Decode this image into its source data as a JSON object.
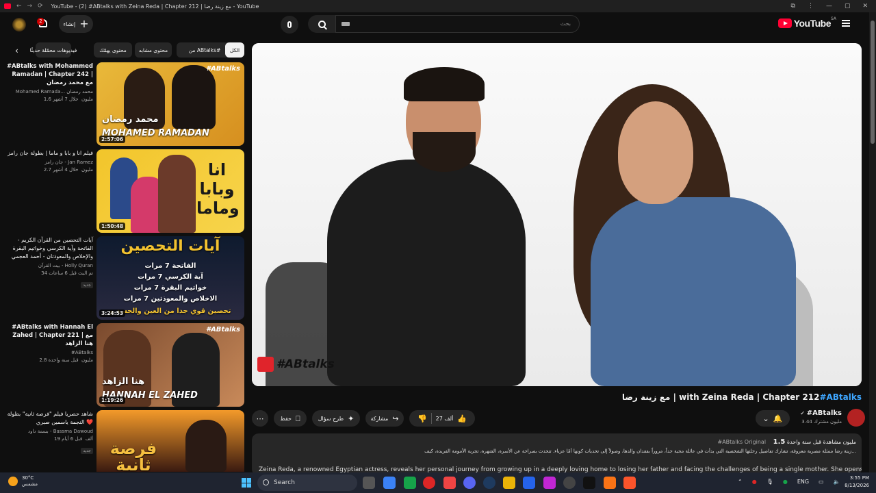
{
  "browser": {
    "title": "YouTube - (2) #ABtalks with Zeina Reda | Chapter 212 | مع زينة رضا - YouTube"
  },
  "header": {
    "logo_text": "YouTube",
    "logo_region": "SA",
    "search_placeholder": "بحث",
    "create_label": "إنشاء",
    "notification_count": "2"
  },
  "chips": [
    {
      "label": "الكل",
      "active": true
    },
    {
      "label": "من ABtalks#",
      "active": false
    },
    {
      "label": "محتوى مشابه",
      "active": false
    },
    {
      "label": "محتوى يهمّك",
      "active": false
    },
    {
      "label": "فيديوهات محمّلة حديثًا",
      "active": false
    }
  ],
  "related": [
    {
      "title": "#ABtalks with Mohammed Ramadan | Chapter 242 | مع محمد رمضان",
      "channel": "Mohamed Ramada... محمد رمضان",
      "stats": "1.6 مليون ‏ خلال 7 أشهر",
      "duration": "2:57:06",
      "thumb_brand": "#ABtalks",
      "thumb_ar": "محمد رمضان",
      "thumb_en": "MOHAMED RAMADAN"
    },
    {
      "title": "فيلم انا و بابا و ماما | بطولة جان رامز",
      "channel": "جان رامز - Jan Ramez",
      "stats": "2.7 مليون ‏ خلال 4 أشهر",
      "duration": "1:50:48",
      "thumb_ar": "انا وبابا وماما"
    },
    {
      "title": "آيات التحصين من القرآن الكريم - الفاتحة وآية الكرسي وخواتيم البقرة والإخلاص والمعوذتان - أحمد العجمي",
      "channel": "بيت القرآن - Holly Quran",
      "stats": "34 تم البث قبل 6 ساعات",
      "badge": "جديد",
      "duration": "3:24:53",
      "thumb_title": "آيات التحصين",
      "thumb_lines": [
        "الفاتحة 7 مرات",
        "آية الكرسي 7 مرات",
        "خواتيم البقرة 7 مرات",
        "الاخلاص والمعوذتين 7 مرات",
        "تحصين قوي جدا من العين والحسد و"
      ]
    },
    {
      "title": "#ABtalks with Hannah El Zahed | Chapter 221 | مع هنا الزاهد",
      "channel": "#ABtalks",
      "stats": "2.8 مليون ‏ قبل سنة واحدة",
      "duration": "1:19:26",
      "thumb_brand": "#ABtalks",
      "thumb_ar": "هنا الزاهد",
      "thumb_en": "HANNAH EL ZAHED"
    },
    {
      "title": "شاهد حصريا فيلم \"فرصة ثانية\" بطولة النجمة ياسمين صبري ❤️",
      "channel": "بسمة داود - Bassma Dawoud",
      "stats": "19 ألف ‏ قبل 6 أيام",
      "badge": "جديد",
      "thumb_ar": "فرصة ثانية"
    }
  ],
  "player": {
    "watermark": "#ABtalks"
  },
  "video": {
    "title_hash": "#ABtalks",
    "title_rest": "مع زينة رضا | with Zeina Reda | Chapter 212",
    "channel": "#ABtalks",
    "subs": "3.44 مليون مشترك",
    "likes": "27 ألف",
    "share_label": "مشاركة",
    "ask_label": "طرح سؤال",
    "save_label": "حفظ"
  },
  "description": {
    "views": "1.5",
    "views_rest": "مليون مشاهدة  قبل سنة واحدة",
    "tag": "#ABtalks Original",
    "text_ar": "زينة رضا ممثلة مصرية معروفة، تشارك تفاصيل رحلتها الشخصية التي بدأت في عائلة محبة جداً، مروراً بفقدان والدها، وصولاً إلى تحديات كونها أمًا عزباء. تتحدث بصراحة عن الأسرة، الشهرة، تجربة الأمومة الفريدة، كيف...",
    "text_en": "Zeina Reda, a renowned Egyptian actress, reveals her personal journey from growing up in a deeply loving home to losing her father and facing the challenges of being a single mother. She opens up about h"
  },
  "taskbar": {
    "temp": "30°C",
    "weather": "مشمس",
    "search": "Search",
    "lang": "ENG",
    "time": "3:55 PM",
    "date": "8/13/2026"
  }
}
